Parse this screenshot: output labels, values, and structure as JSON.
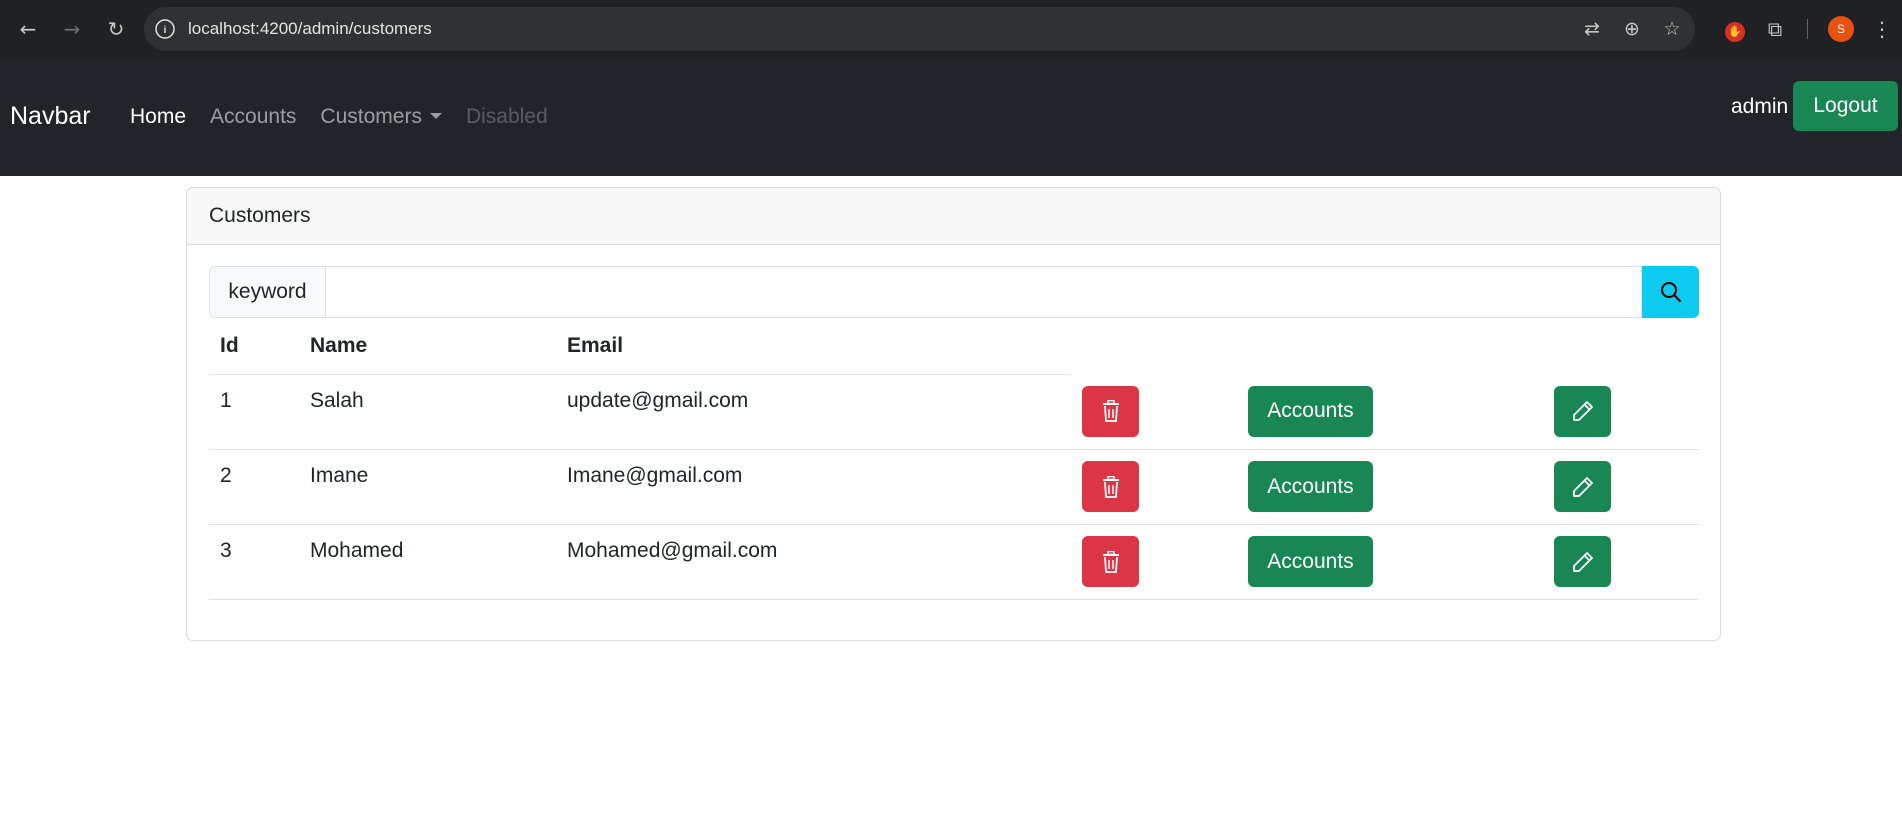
{
  "browser": {
    "url": "localhost:4200/admin/customers",
    "profile_initial": "S"
  },
  "navbar": {
    "brand": "Navbar",
    "links": [
      {
        "label": "Home",
        "state": "active"
      },
      {
        "label": "Accounts",
        "state": "normal"
      },
      {
        "label": "Customers",
        "state": "dropdown"
      },
      {
        "label": "Disabled",
        "state": "disabled"
      }
    ],
    "username": "admin",
    "logout_label": "Logout"
  },
  "card": {
    "header": "Customers",
    "search": {
      "label": "keyword",
      "value": "",
      "placeholder": ""
    },
    "table": {
      "columns": [
        "Id",
        "Name",
        "Email"
      ],
      "rows": [
        {
          "id": "1",
          "name": "Salah",
          "email": "update@gmail.com",
          "accounts_label": "Accounts"
        },
        {
          "id": "2",
          "name": "Imane",
          "email": "Imane@gmail.com",
          "accounts_label": "Accounts"
        },
        {
          "id": "3",
          "name": "Mohamed",
          "email": "Mohamed@gmail.com",
          "accounts_label": "Accounts"
        }
      ]
    }
  },
  "colors": {
    "navbar_bg": "#212529",
    "success": "#198754",
    "danger": "#dc3545",
    "info": "#0dcaf0"
  },
  "icons": {
    "delete": "trash-icon",
    "edit": "pencil-icon",
    "search": "search-icon"
  }
}
